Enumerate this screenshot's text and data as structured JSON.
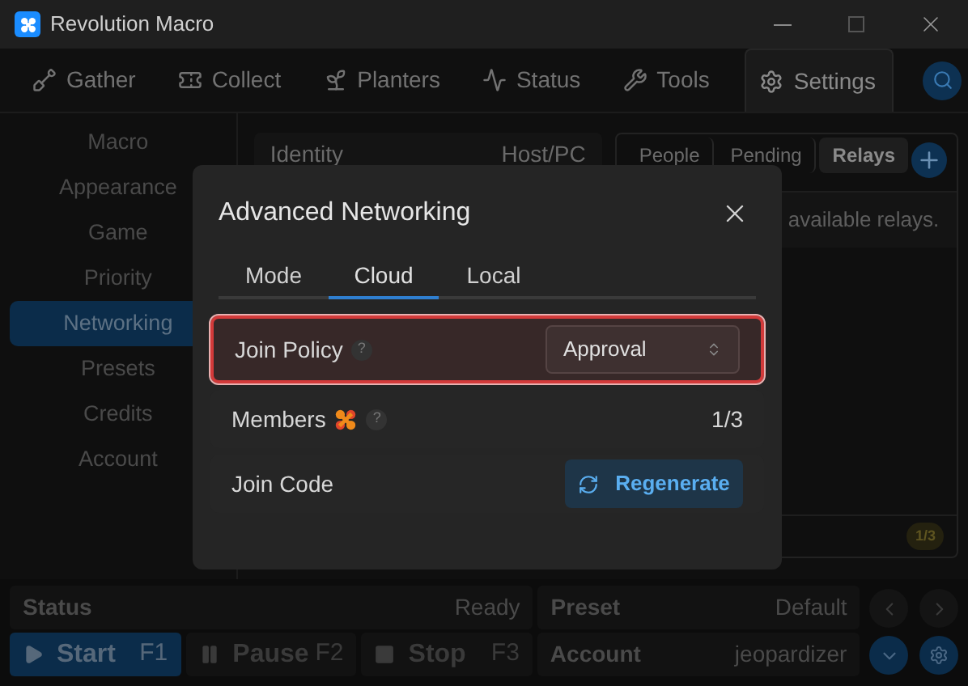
{
  "window": {
    "title": "Revolution Macro"
  },
  "nav_tabs": [
    {
      "label": "Gather",
      "selected": false
    },
    {
      "label": "Collect",
      "selected": false
    },
    {
      "label": "Planters",
      "selected": false
    },
    {
      "label": "Status",
      "selected": false
    },
    {
      "label": "Tools",
      "selected": false
    },
    {
      "label": "Settings",
      "selected": true
    }
  ],
  "sidebar": {
    "items": [
      {
        "label": "Macro",
        "selected": false
      },
      {
        "label": "Appearance",
        "selected": false
      },
      {
        "label": "Game",
        "selected": false
      },
      {
        "label": "Priority",
        "selected": false
      },
      {
        "label": "Networking",
        "selected": true
      },
      {
        "label": "Presets",
        "selected": false
      },
      {
        "label": "Credits",
        "selected": false
      },
      {
        "label": "Account",
        "selected": false
      }
    ]
  },
  "identity_table": {
    "columns": [
      "Identity",
      "Host/PC"
    ]
  },
  "relays_panel": {
    "tabs": [
      {
        "label": "People",
        "selected": false
      },
      {
        "label": "Pending",
        "selected": false
      },
      {
        "label": "Relays",
        "selected": true
      }
    ],
    "message": "available relays.",
    "badge": "1/3"
  },
  "dialog": {
    "title": "Advanced Networking",
    "tabs": [
      {
        "label": "Mode",
        "selected": false
      },
      {
        "label": "Cloud",
        "selected": true
      },
      {
        "label": "Local",
        "selected": false
      }
    ],
    "rows": [
      {
        "kind": "select",
        "label": "Join Policy",
        "help": "?",
        "value": "Approval",
        "highlighted": true
      },
      {
        "kind": "count",
        "label": "Members",
        "help": "?",
        "value": "1/3",
        "highlighted": false
      },
      {
        "kind": "button",
        "label": "Join Code",
        "value": "Regenerate",
        "highlighted": false
      }
    ]
  },
  "status_bar": {
    "status": {
      "label": "Status",
      "value": "Ready"
    },
    "preset": {
      "label": "Preset",
      "value": "Default"
    },
    "controls": [
      {
        "label": "Start",
        "key": "F1",
        "selected": true
      },
      {
        "label": "Pause",
        "key": "F2",
        "selected": false
      },
      {
        "label": "Stop",
        "key": "F3",
        "selected": false
      }
    ],
    "account": {
      "label": "Account",
      "value": "jeopardizer"
    }
  }
}
